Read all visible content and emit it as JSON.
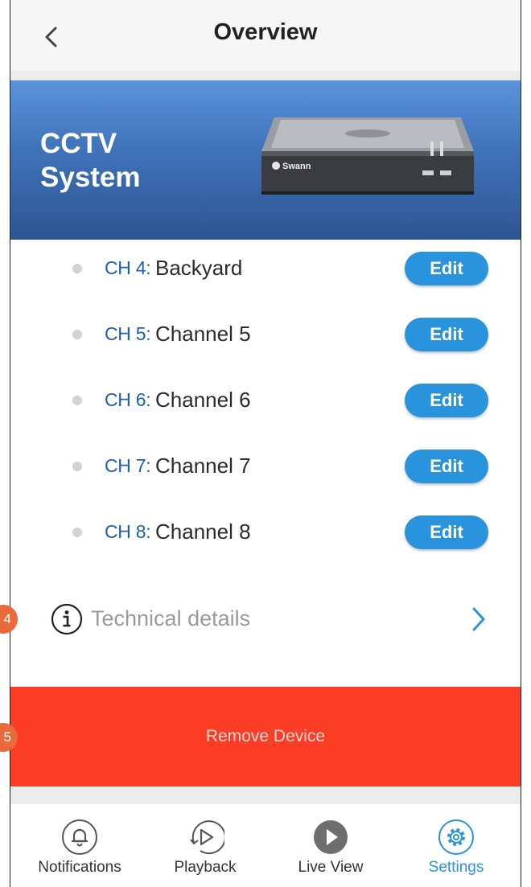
{
  "header": {
    "title": "Overview"
  },
  "banner": {
    "title_line1": "CCTV",
    "title_line2": "System",
    "brand": "Swann"
  },
  "channels": [
    {
      "num": "CH 4:",
      "name": "Backyard",
      "edit": "Edit"
    },
    {
      "num": "CH 5:",
      "name": "Channel 5",
      "edit": "Edit"
    },
    {
      "num": "CH 6:",
      "name": "Channel 6",
      "edit": "Edit"
    },
    {
      "num": "CH 7:",
      "name": "Channel 7",
      "edit": "Edit"
    },
    {
      "num": "CH 8:",
      "name": "Channel 8",
      "edit": "Edit"
    }
  ],
  "technical": {
    "label": "Technical details",
    "badge": "4"
  },
  "remove": {
    "label": "Remove Device",
    "badge": "5"
  },
  "tabs": [
    {
      "label": "Notifications",
      "icon": "bell-icon"
    },
    {
      "label": "Playback",
      "icon": "playback-icon"
    },
    {
      "label": "Live View",
      "icon": "play-icon"
    },
    {
      "label": "Settings",
      "icon": "gear-icon",
      "active": true
    }
  ],
  "colors": {
    "accent": "#2a93dd",
    "danger": "#fb3d25",
    "banner": "#3f72b8",
    "badge": "#e86a3c"
  }
}
